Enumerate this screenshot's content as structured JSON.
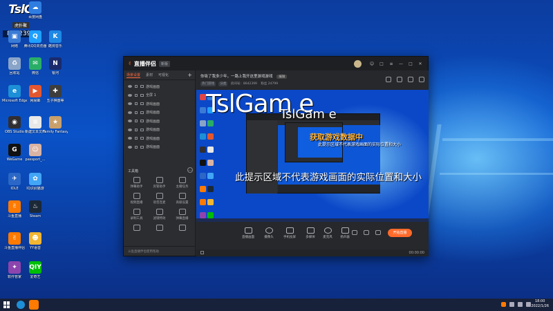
{
  "desktop": {
    "overlay": {
      "logo": "TslG",
      "tag": "虎扑聚",
      "number": "8642399"
    },
    "icons": [
      {
        "label": "",
        "color": "#d73a2f",
        "glyph": ""
      },
      {
        "label": "百度网盘",
        "color": "#2f7de1",
        "glyph": "☁"
      },
      {
        "label": "网络",
        "color": "#3a7bd5",
        "glyph": "▣"
      },
      {
        "label": "腾讯QQ浏览器",
        "color": "#1fa0ff",
        "glyph": "Q"
      },
      {
        "label": "酷狗音乐",
        "color": "#1e88e5",
        "glyph": "K"
      },
      {
        "label": "回收站",
        "color": "#8aa4c8",
        "glyph": "♻"
      },
      {
        "label": "微信",
        "color": "#2aae67",
        "glyph": "✉"
      },
      {
        "label": "银河",
        "color": "#1a2a6c",
        "glyph": "N"
      },
      {
        "label": "Microsoft Edge",
        "color": "#1d8fd6",
        "glyph": "e"
      },
      {
        "label": "网易邮",
        "color": "#e4572e",
        "glyph": "▶"
      },
      {
        "label": "五子棋盘等",
        "color": "#3d3d3d",
        "glyph": "✚"
      },
      {
        "label": "OBS Studio",
        "color": "#302e31",
        "glyph": "◉"
      },
      {
        "label": "新建文本文件",
        "color": "#e8e8e8",
        "glyph": "≡"
      },
      {
        "label": "Family Fantasy ...",
        "color": "#c9a06b",
        "glyph": "★"
      },
      {
        "label": "WeGame",
        "color": "#111111",
        "glyph": "G"
      },
      {
        "label": "passport_...",
        "color": "#d9b3a3",
        "glyph": "☺"
      },
      {
        "label": "IDLE",
        "color": "#2b67c6",
        "glyph": "✈"
      },
      {
        "label": "IQ识别猫游",
        "color": "#42a5f5",
        "glyph": "✿"
      },
      {
        "label": "斗鱼直播",
        "color": "#ff7a00",
        "glyph": "✌"
      },
      {
        "label": "Steam",
        "color": "#1b2838",
        "glyph": "♨"
      },
      {
        "label": "斗鱼直播伴侣",
        "color": "#ff7a00",
        "glyph": "✌"
      },
      {
        "label": "YY语音",
        "color": "#f2b632",
        "glyph": "☻"
      },
      {
        "label": "软件管家",
        "color": "#8e44ad",
        "glyph": "✦"
      },
      {
        "label": "爱奇艺",
        "color": "#00be06",
        "glyph": "QIY"
      }
    ]
  },
  "app": {
    "title": "直播伴侣",
    "version": "新版",
    "window_controls": [
      "☺",
      "□",
      "≡",
      "—",
      "□",
      "✕"
    ],
    "left_tabs": {
      "scenes": "场景设置",
      "sources": "素材",
      "widgets": "可视化",
      "add": "+"
    },
    "scenes": [
      "游戏画面",
      "全屏 1",
      "游戏画面",
      "游戏画面",
      "游戏画面",
      "游戏画面",
      "游戏画面",
      "游戏画面"
    ],
    "tools_title": "工具箱",
    "tools": [
      "弹幕助手",
      "房管助手",
      "主播任务",
      "视频直播",
      "语音连麦",
      "高级设置",
      "录制工具",
      "滤镜特效",
      "弹幕直播",
      "",
      "",
      ""
    ],
    "footer": "斗鱼直播伴侣使用帮助",
    "stream_title": "你吸了我多少年，一路上我开这里游戏游戏",
    "edit_label": "编辑",
    "meta": {
      "category": "热门游戏",
      "sub": "分类",
      "room": "房间号：8642399",
      "fans": "粉丝 24799"
    },
    "header_icons": [
      "gift-icon",
      "lock-icon",
      "link-icon",
      "share-icon"
    ],
    "watermark_big": "TslGam  e",
    "watermark_mid": "TslGam   e",
    "overlay_get": "获取游戏数据中",
    "overlay_hint_small": "此提示区域不代表游戏画面的实际位置和大小",
    "overlay_hint": "此提示区域不代表游戏画面的实际位置和大小",
    "controls": [
      "直播画面",
      "摄像头",
      "手机投屏",
      "多媒体",
      "麦克风",
      "扬声器"
    ],
    "live_button": "开始直播",
    "duration": "00:00:00"
  },
  "taskbar": {
    "apps": [
      "edge",
      "doyu-companion"
    ],
    "clock_time": "18:00",
    "clock_date": "2022/1/26"
  }
}
